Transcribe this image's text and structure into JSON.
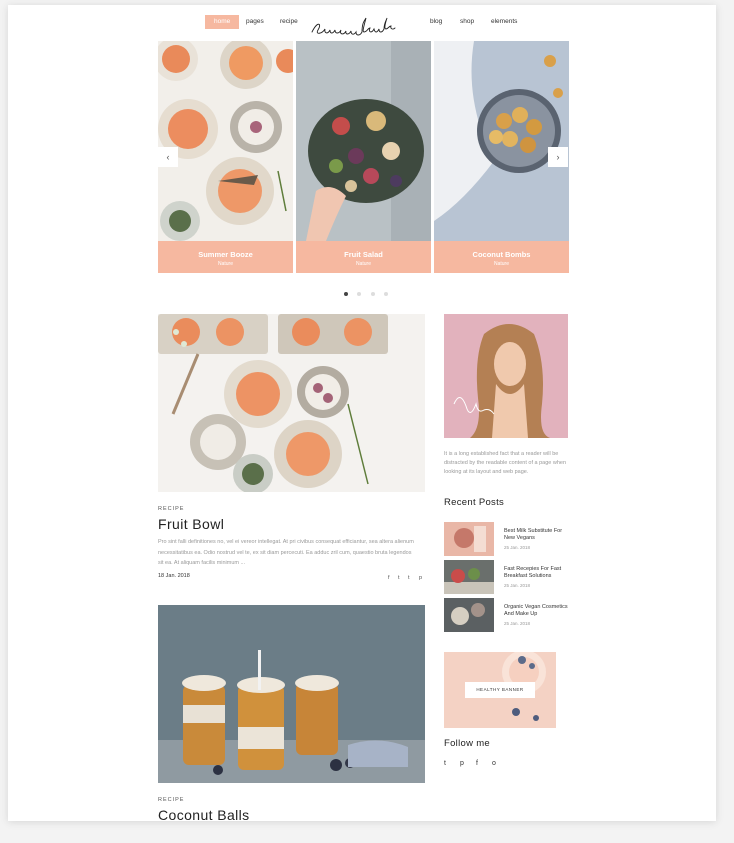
{
  "nav": {
    "items": [
      "home",
      "pages",
      "recipe",
      "blog",
      "shop",
      "elements"
    ],
    "active": "home",
    "logo_text": "Succulents"
  },
  "slider": {
    "slides": [
      {
        "title": "Summer Booze",
        "subtitle": "Nature"
      },
      {
        "title": "Fruit Salad",
        "subtitle": "Nature"
      },
      {
        "title": "Coconut Bombs",
        "subtitle": "Nature"
      }
    ],
    "prev_glyph": "‹",
    "next_glyph": "›",
    "dot_count": 4,
    "active_dot": 0,
    "accent": "#f6b8a0"
  },
  "posts": [
    {
      "category": "RECIPE",
      "title": "Fruit Bowl",
      "excerpt": "Pro sint falli definitiones no, vel ei vereor intellegat. At pri civibus consequat efficiantur, sea altera alienum necessitatibus ea. Odio nostrud vel te, ex sit diam percecuti. Ea adduc zril cum, quaestio bruta legendos sit ea. At aliquam facilis minimum ...",
      "date": "18 Jan. 2018",
      "share_icons": [
        "f",
        "t",
        "t",
        "p"
      ]
    },
    {
      "category": "RECIPE",
      "title": "Coconut Balls"
    }
  ],
  "sidebar": {
    "about_text": "It is a long established fact that a reader will be distracted by the readable content of a page when looking at its layout and web page.",
    "recent_title": "Recent Posts",
    "recent_posts": [
      {
        "title": "Best Milk Substitute For New Vegans",
        "date": "25 Jan. 2018"
      },
      {
        "title": "Fast Recepies For Fast Breakfast Solutions",
        "date": "25 Jan. 2018"
      },
      {
        "title": "Organic Vegan Cosmetics And Make Up",
        "date": "25 Jan. 2018"
      }
    ],
    "banner_label": "HEALTHY BANNER",
    "follow_title": "Follow me",
    "social_icons": [
      "t",
      "p",
      "f",
      "o"
    ]
  }
}
